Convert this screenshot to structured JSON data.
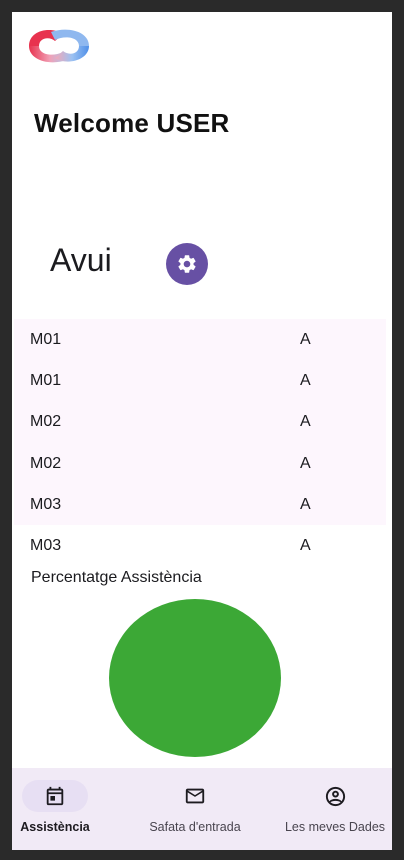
{
  "header": {
    "welcome": "Welcome USER"
  },
  "today": {
    "title": "Avui",
    "settings_icon": "gear-icon"
  },
  "schedule": [
    {
      "module": "M01",
      "value": "A"
    },
    {
      "module": "M01",
      "value": "A"
    },
    {
      "module": "M02",
      "value": "A"
    },
    {
      "module": "M02",
      "value": "A"
    },
    {
      "module": "M03",
      "value": "A"
    },
    {
      "module": "M03",
      "value": "A"
    }
  ],
  "attendance": {
    "label": "Percentatge Assistència",
    "chart_data": {
      "type": "pie",
      "slices": [
        {
          "value": 100,
          "color": "#3ca836"
        }
      ]
    }
  },
  "bottom_nav": {
    "items": [
      {
        "label": "Assistència",
        "icon": "calendar-icon",
        "active": true
      },
      {
        "label": "Safata d'entrada",
        "icon": "mail-icon",
        "active": false
      },
      {
        "label": "Les meves Dades",
        "icon": "account-circle-icon",
        "active": false
      }
    ]
  },
  "colors": {
    "accent": "#6750a4",
    "pie_fill": "#3ca836",
    "nav_background": "#f1eaf6",
    "list_background": "#fdf6fd"
  }
}
